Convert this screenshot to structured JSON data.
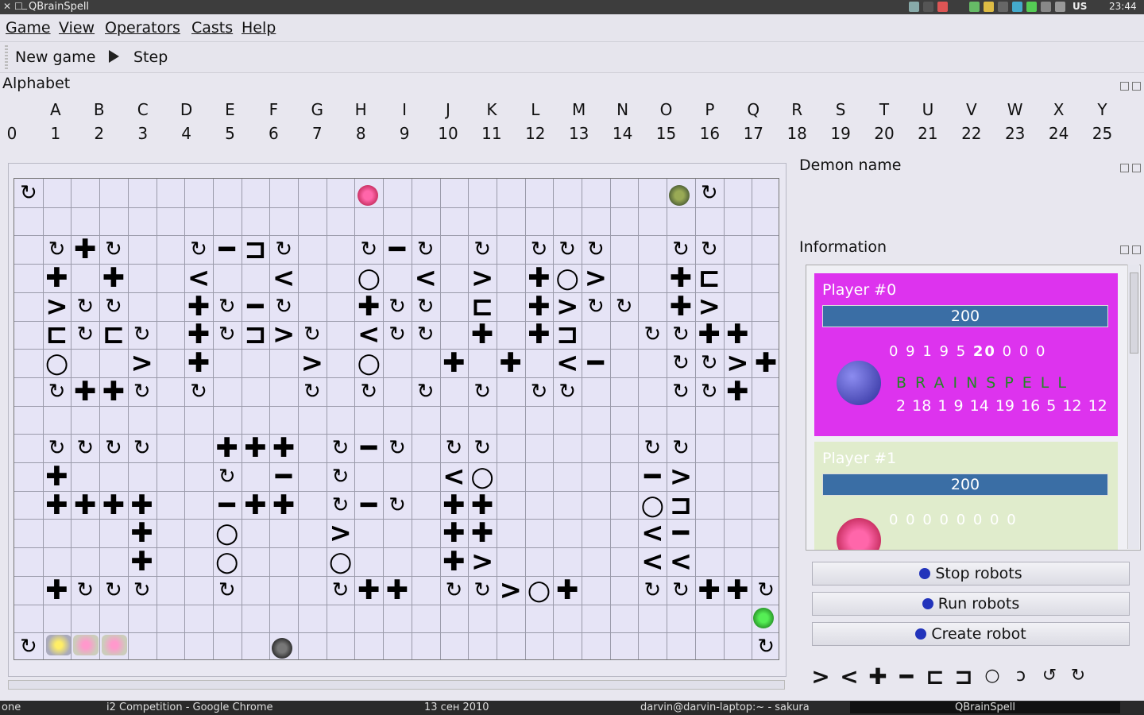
{
  "window": {
    "title": "QBrainSpell"
  },
  "tray": {
    "keyboard": "US",
    "time": "23:44"
  },
  "menu": [
    "Game",
    "View",
    "Operators",
    "Casts",
    "Help"
  ],
  "toolbar": {
    "new_game": "New game",
    "step": "Step"
  },
  "alphabet": {
    "title": "Alphabet",
    "letters": [
      "A",
      "B",
      "C",
      "D",
      "E",
      "F",
      "G",
      "H",
      "I",
      "J",
      "K",
      "L",
      "M",
      "N",
      "O",
      "P",
      "Q",
      "R",
      "S",
      "T",
      "U",
      "V",
      "W",
      "X",
      "Y"
    ],
    "numbers": [
      "0",
      "1",
      "2",
      "3",
      "4",
      "5",
      "6",
      "7",
      "8",
      "9",
      "10",
      "11",
      "12",
      "13",
      "14",
      "15",
      "16",
      "17",
      "18",
      "19",
      "20",
      "21",
      "22",
      "23",
      "24",
      "25"
    ]
  },
  "demon": {
    "title": "Demon name"
  },
  "info": {
    "title": "Information",
    "players": [
      {
        "name": "Player #0",
        "value": "200",
        "digits_before": "0 9 1 9 5 ",
        "digits_bold": "20",
        "digits_after": " 0 0 0",
        "word": "BRAINSPELL",
        "codes": "2 18 1 9 14 19 16 5 12 12",
        "color": "#dd33ee"
      },
      {
        "name": "Player #1",
        "value": "200",
        "digits": "0 0 0 0 0 0 0 0",
        "color": "#e0eccc"
      }
    ]
  },
  "buttons": {
    "stop": "Stop robots",
    "run": "Run robots",
    "create": "Create robot"
  },
  "operators": [
    ">",
    "<",
    "+",
    "−",
    "[",
    "]",
    "o",
    "ↄ",
    "↺",
    "↻"
  ],
  "board": {
    "cols": 27,
    "rows": 17,
    "rows_data": [
      "r.......................r..r",
      "...........................",
      ".r+r..r-]r..r-r.r.rrr..rr..",
      ".+.+..<..<..o.<.>.+o>..+[..",
      ".>rr..+r-r..+rr.[.+>rr.+>..",
      ".[r[r.+r]>r.<rr.+.+]..rr++.",
      ".o..>.+...>.o..+.+.<-..rr>+",
      ".r++r.r...r.r.r.r.rr...rr+.",
      "...........................",
      ".rrrr..+++.r-r.rr.....rr...",
      ".+.....r.-.r...<o.....->...",
      ".++++..-++.r-r.++.....o]...",
      "....+..o...>...++.....<-...",
      "....+..o...o...+>.....<<...",
      ".+rrr..r...r++.rr>o+..rr++r",
      "...........................",
      "r.........................r"
    ]
  },
  "taskbar": {
    "t1": "one",
    "t2": "i2 Competition - Google Chrome",
    "t3": "13 сен 2010",
    "t4": "darvin@darvin-laptop:~ - sakura",
    "t5": "QBrainSpell"
  }
}
